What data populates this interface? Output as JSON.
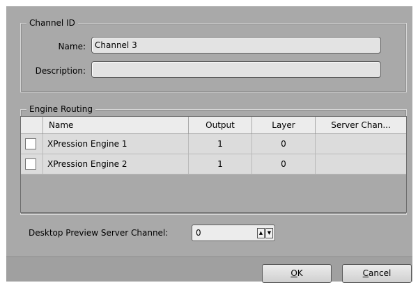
{
  "channel_id": {
    "legend": "Channel ID",
    "name_label": "Name:",
    "name_value": "Channel 3",
    "description_label": "Description:",
    "description_value": ""
  },
  "engine_routing": {
    "legend": "Engine Routing",
    "columns": [
      "Name",
      "Output",
      "Layer",
      "Server Chan..."
    ],
    "rows": [
      {
        "checked": false,
        "name": "XPression Engine 1",
        "output": "1",
        "layer": "0",
        "server_channel": ""
      },
      {
        "checked": false,
        "name": "XPression Engine 2",
        "output": "1",
        "layer": "0",
        "server_channel": ""
      }
    ]
  },
  "preview": {
    "label": "Desktop Preview Server Channel:",
    "value": "0"
  },
  "buttons": {
    "ok_mnemonic": "O",
    "ok_rest": "K",
    "cancel_mnemonic": "C",
    "cancel_rest": "ancel"
  }
}
